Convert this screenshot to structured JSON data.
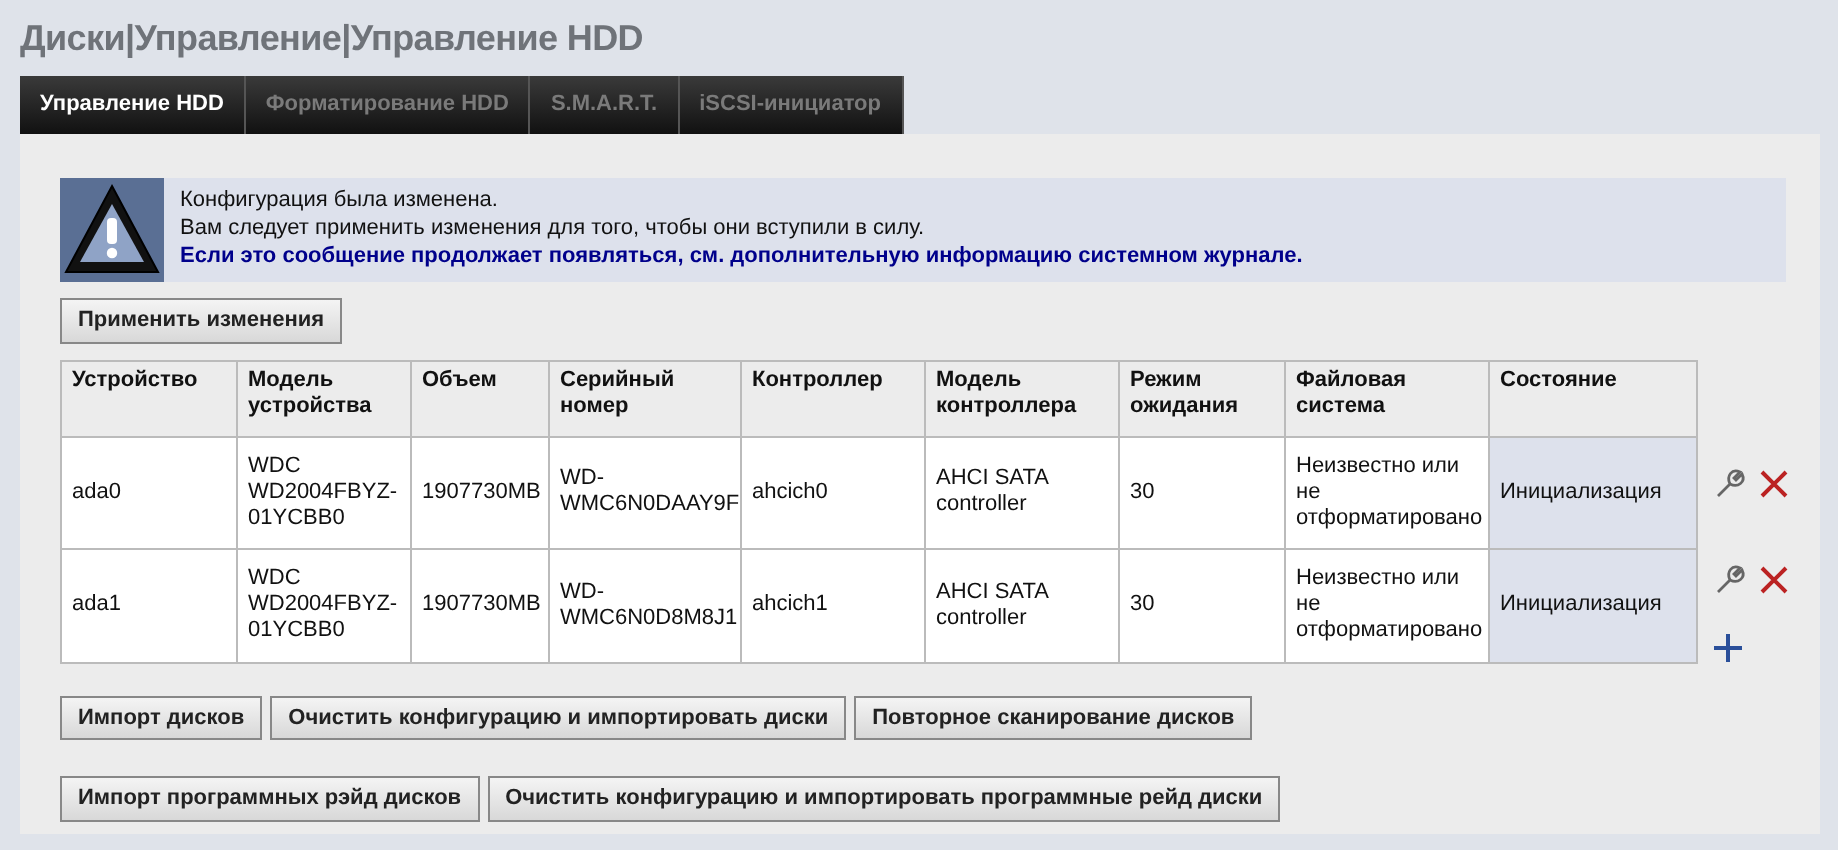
{
  "title": "Диски|Управление|Управление HDD",
  "tabs": [
    {
      "label": "Управление HDD",
      "selected": true
    },
    {
      "label": "Форматирование HDD",
      "selected": false
    },
    {
      "label": "S.M.A.R.T.",
      "selected": false
    },
    {
      "label": "iSCSI-инициатор",
      "selected": false
    }
  ],
  "alert": {
    "lines": [
      "Конфигурация была изменена.",
      "Вам следует применить изменения для того, чтобы они вступили в силу."
    ],
    "note": "Если это сообщение продолжает появляться, см. дополнительную информацию системном журнале."
  },
  "apply_button": "Применить изменения",
  "table": {
    "columns": [
      "Устройство",
      "Модель устройства",
      "Объем",
      "Серийный номер",
      "Контроллер",
      "Модель контроллера",
      "Режим ожидания",
      "Файловая система",
      "Состояние"
    ],
    "rows": [
      {
        "cells": [
          "ada0",
          "WDC WD2004FBYZ-01YCBB0",
          "1907730MB",
          "WD-WMC6N0DAAY9F",
          "ahcich0",
          "AHCI SATA controller",
          "30",
          "Неизвестно или не отформатировано",
          "Инициализация"
        ]
      },
      {
        "cells": [
          "ada1",
          "WDC WD2004FBYZ-01YCBB0",
          "1907730MB",
          "WD-WMC6N0D8M8J1",
          "ahcich1",
          "AHCI SATA controller",
          "30",
          "Неизвестно или не отформатировано",
          "Инициализация"
        ]
      }
    ]
  },
  "button_rows": [
    [
      "Импорт дисков",
      "Очистить конфигурацию и импортировать диски",
      "Повторное сканирование дисков"
    ],
    [
      "Импорт программных рэйд дисков",
      "Очистить конфигурацию и импортировать программные рейд диски"
    ]
  ]
}
